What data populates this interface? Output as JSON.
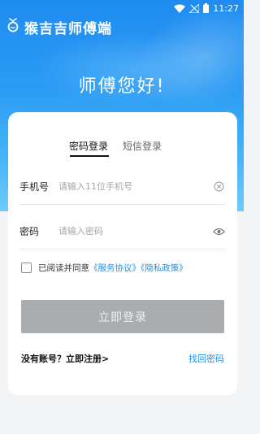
{
  "status_bar": {
    "time": "11:27",
    "icons": [
      "wifi-icon",
      "signal-off-icon",
      "battery-icon"
    ]
  },
  "app": {
    "title": "猴吉吉师傅端",
    "logo_icon": "bulb-logo-icon"
  },
  "greeting": "师傅您好!",
  "tabs": [
    {
      "label": "密码登录",
      "active": true
    },
    {
      "label": "短信登录",
      "active": false
    }
  ],
  "phone": {
    "label": "手机号",
    "placeholder": "请输入11位手机号",
    "value": "",
    "trail_icon": "clear-circle-icon"
  },
  "password": {
    "label": "密码",
    "placeholder": "请输入密码",
    "value": "",
    "trail_icon": "eye-icon"
  },
  "agreement": {
    "checked": false,
    "text": "已阅读并同意",
    "service_link": "《服务协议》",
    "privacy_link": "《隐私政策》"
  },
  "login_button": "立即登录",
  "register_link": "没有账号？立即注册>",
  "forgot_link": "找回密码",
  "colors": {
    "brand_blue": "#1f8cf0",
    "link_blue": "#1e8fe6",
    "button_disabled": "#a9adaf"
  }
}
